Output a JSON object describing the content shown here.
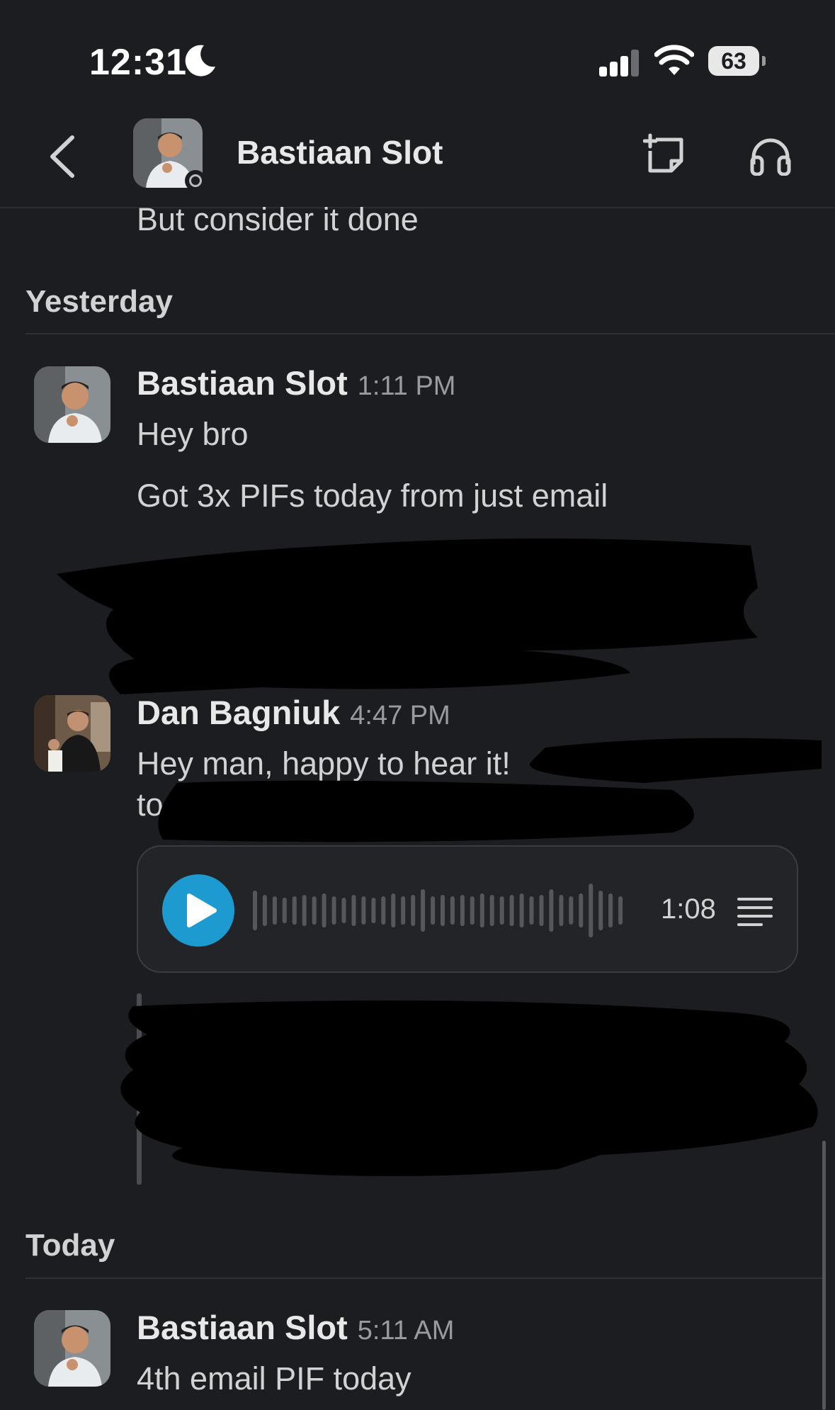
{
  "status_bar": {
    "time": "12:31",
    "battery": "63"
  },
  "header": {
    "name": "Bastiaan Slot"
  },
  "previous_message": {
    "text": "But consider it done"
  },
  "days": [
    {
      "label": "Yesterday",
      "messages": [
        {
          "sender": "Bastiaan Slot",
          "time": "1:11 PM",
          "lines": [
            "Hey bro",
            "Got 3x PIFs today from just email"
          ]
        },
        {
          "sender": "Dan Bagniuk",
          "time": "4:47 PM",
          "lines": [
            "Hey man, happy to hear it!",
            "to"
          ],
          "audio": {
            "duration": "1:08",
            "progress": 0
          }
        }
      ]
    },
    {
      "label": "Today",
      "messages": [
        {
          "sender": "Bastiaan Slot",
          "time": "5:11 AM",
          "lines": [
            "4th email PIF today"
          ]
        }
      ]
    }
  ],
  "colors": {
    "background": "#1b1d21",
    "play_button": "#1d9bd1",
    "link": "#1d9bd1"
  },
  "icons": [
    "moon-icon",
    "signal-icon",
    "wifi-icon",
    "battery-icon",
    "back-chevron-icon",
    "canvas-icon",
    "headphones-icon",
    "play-icon",
    "waveform-icon",
    "transcript-icon"
  ]
}
